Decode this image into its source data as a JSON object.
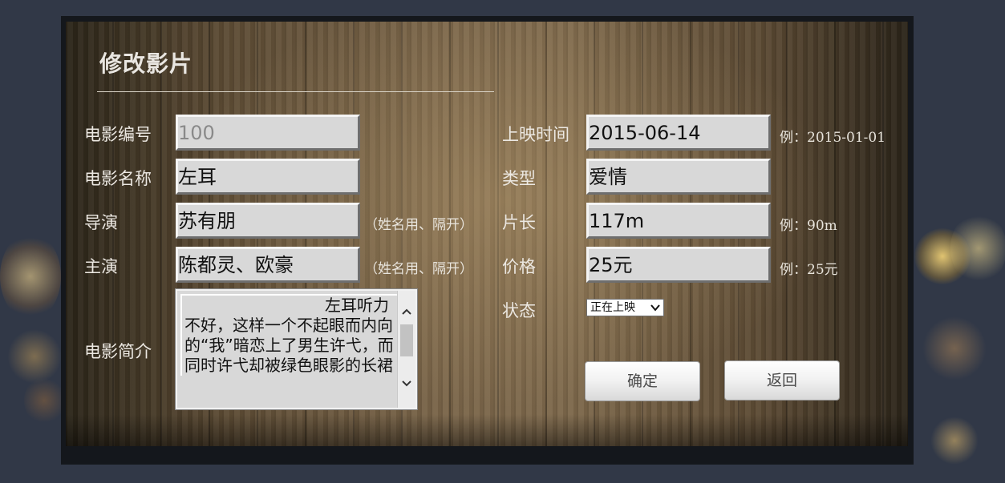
{
  "page": {
    "title": "修改影片"
  },
  "form": {
    "id_label": "电影编号",
    "id_value": "100",
    "name_label": "电影名称",
    "name_value": "左耳",
    "director_label": "导演",
    "director_value": "苏有朋",
    "director_hint": "（姓名用、隔开）",
    "actors_label": "主演",
    "actors_value": "陈都灵、欧豪",
    "actors_hint": "（姓名用、隔开）",
    "intro_label": "电影简介",
    "intro_value": "左耳听力不好，这样一个不起眼而内向的“我”暗恋上了男生许弋，而同时许弋却被绿色眼影的长裙",
    "release_label": "上映时间",
    "release_value": "2015-06-14",
    "release_hint": "例：2015-01-01",
    "type_label": "类型",
    "type_value": "爱情",
    "length_label": "片长",
    "length_value": "117m",
    "length_hint": "例：90m",
    "price_label": "价格",
    "price_value": "25元",
    "price_hint": "例：25元",
    "status_label": "状态",
    "status_value": "正在上映"
  },
  "buttons": {
    "confirm": "确定",
    "back": "返回"
  },
  "icons": {
    "scroll_up": "chevron-up-icon",
    "scroll_down": "chevron-down-icon",
    "select_caret": "chevron-down-icon"
  },
  "colors": {
    "page_bg": "#313847",
    "label_text": "#ece8e2",
    "field_bg": "#d8d8d8"
  }
}
